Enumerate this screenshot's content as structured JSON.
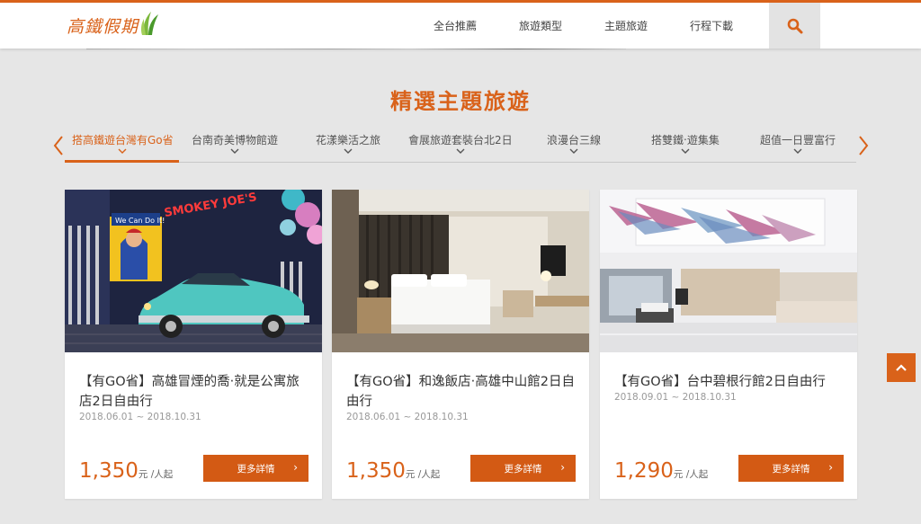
{
  "header": {
    "logo_text": "高鐵假期",
    "nav": [
      "全台推薦",
      "旅遊類型",
      "主題旅遊",
      "行程下載"
    ]
  },
  "section": {
    "title": "精選主題旅遊"
  },
  "tabs": [
    {
      "label": "搭高鐵遊台灣有Go省"
    },
    {
      "label": "台南奇美博物館遊"
    },
    {
      "label": "花漾樂活之旅"
    },
    {
      "label": "會展旅遊套裝台北2日"
    },
    {
      "label": "浪漫台三線"
    },
    {
      "label": "搭雙鐵‧遊集集"
    },
    {
      "label": "超值一日豐富行"
    }
  ],
  "cards": [
    {
      "title": "【有GO省】高雄冒煙的喬‧就是公寓旅店2日自由行",
      "date": "2018.06.01 ~ 2018.10.31",
      "price": "1,350",
      "unit": "元 /人起",
      "button": "更多詳情"
    },
    {
      "title": "【有GO省】和逸飯店‧高雄中山館2日自由行",
      "date": "2018.06.01 ~ 2018.10.31",
      "price": "1,350",
      "unit": "元 /人起",
      "button": "更多詳情"
    },
    {
      "title": "【有GO省】台中碧根行館2日自由行",
      "date": "2018.09.01 ~ 2018.10.31",
      "price": "1,290",
      "unit": "元 /人起",
      "button": "更多詳情"
    }
  ],
  "photo_text": {
    "poster": "We Can Do It!",
    "neon": "SMOKEY JOE'S"
  },
  "colors": {
    "accent": "#d9621a",
    "button": "#d35a14"
  }
}
